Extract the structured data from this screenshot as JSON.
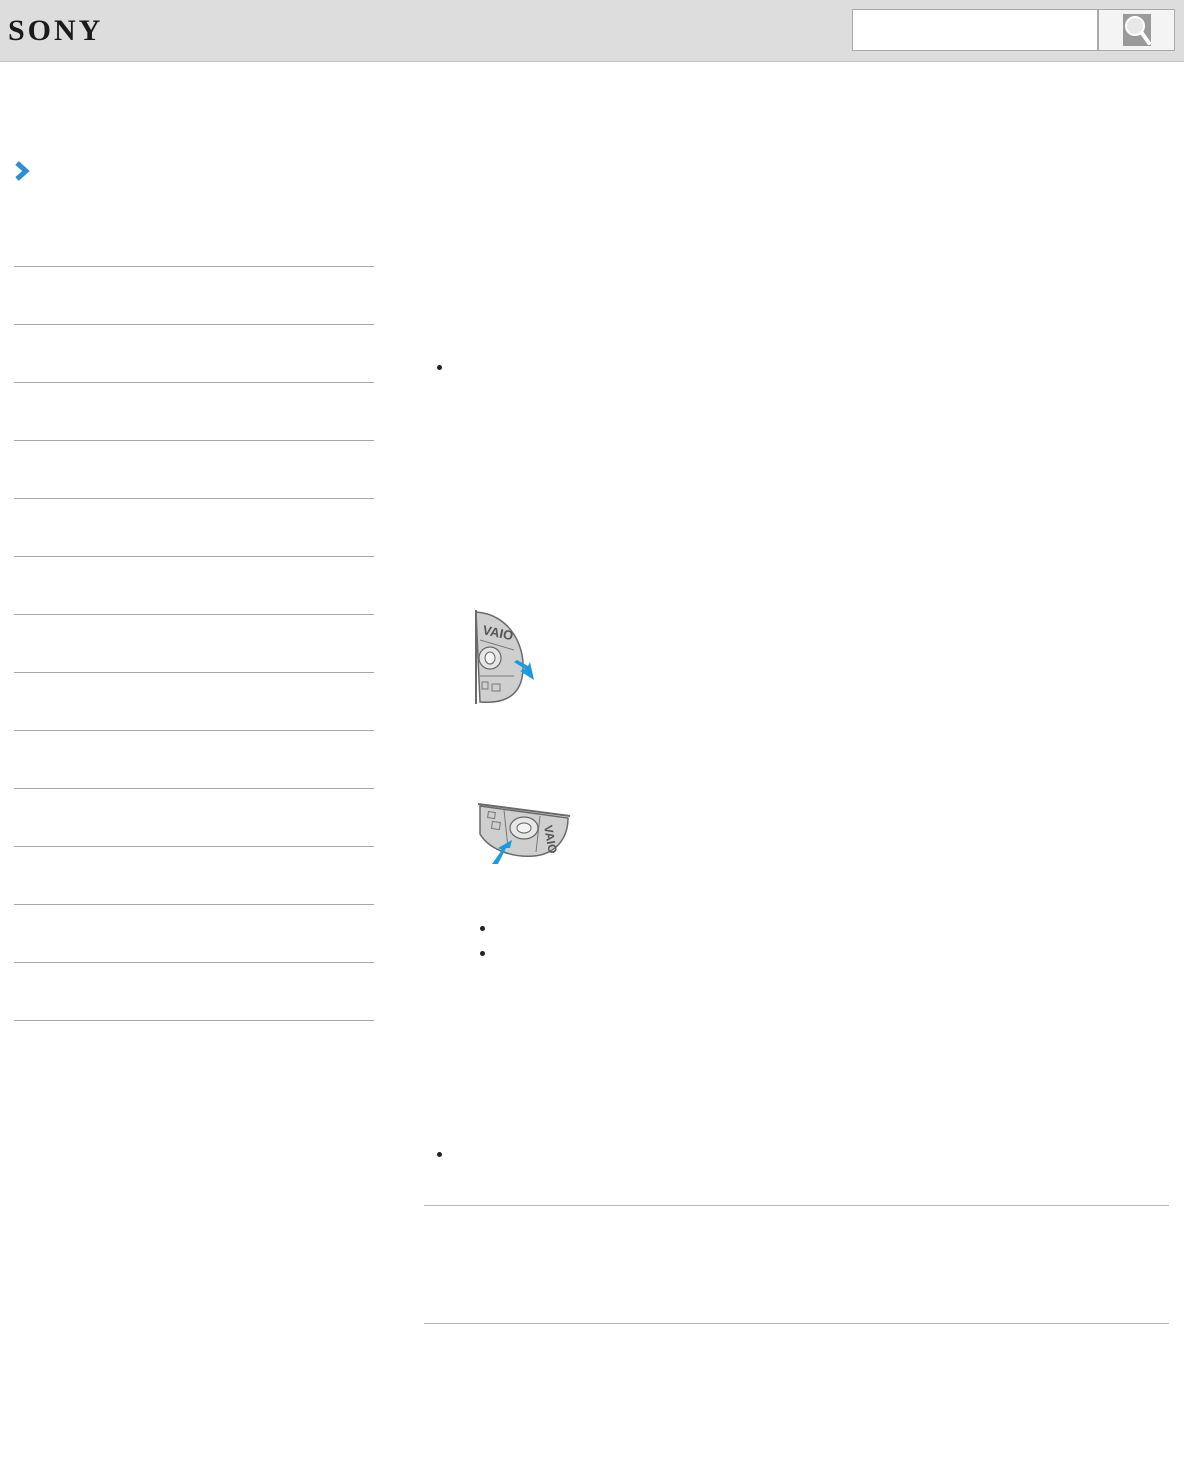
{
  "header": {
    "logo_text": "SONY",
    "search": {
      "placeholder": "",
      "value": ""
    },
    "search_button_icon": "magnifier-icon"
  },
  "sidebar": {
    "expand_icon": "chevron-right-icon",
    "accent_color": "#2a8fd6",
    "items": [
      {
        "label": ""
      },
      {
        "label": ""
      },
      {
        "label": ""
      },
      {
        "label": ""
      },
      {
        "label": ""
      },
      {
        "label": ""
      },
      {
        "label": ""
      },
      {
        "label": ""
      },
      {
        "label": ""
      },
      {
        "label": ""
      },
      {
        "label": ""
      },
      {
        "label": ""
      },
      {
        "label": ""
      }
    ]
  },
  "content": {
    "illustrations": [
      {
        "name": "disc-drive-eject-vertical",
        "logo_text": "VAIO"
      },
      {
        "name": "disc-drive-eject-horizontal",
        "logo_text": "VAIO"
      }
    ],
    "arrow_color": "#1a9ae0"
  }
}
